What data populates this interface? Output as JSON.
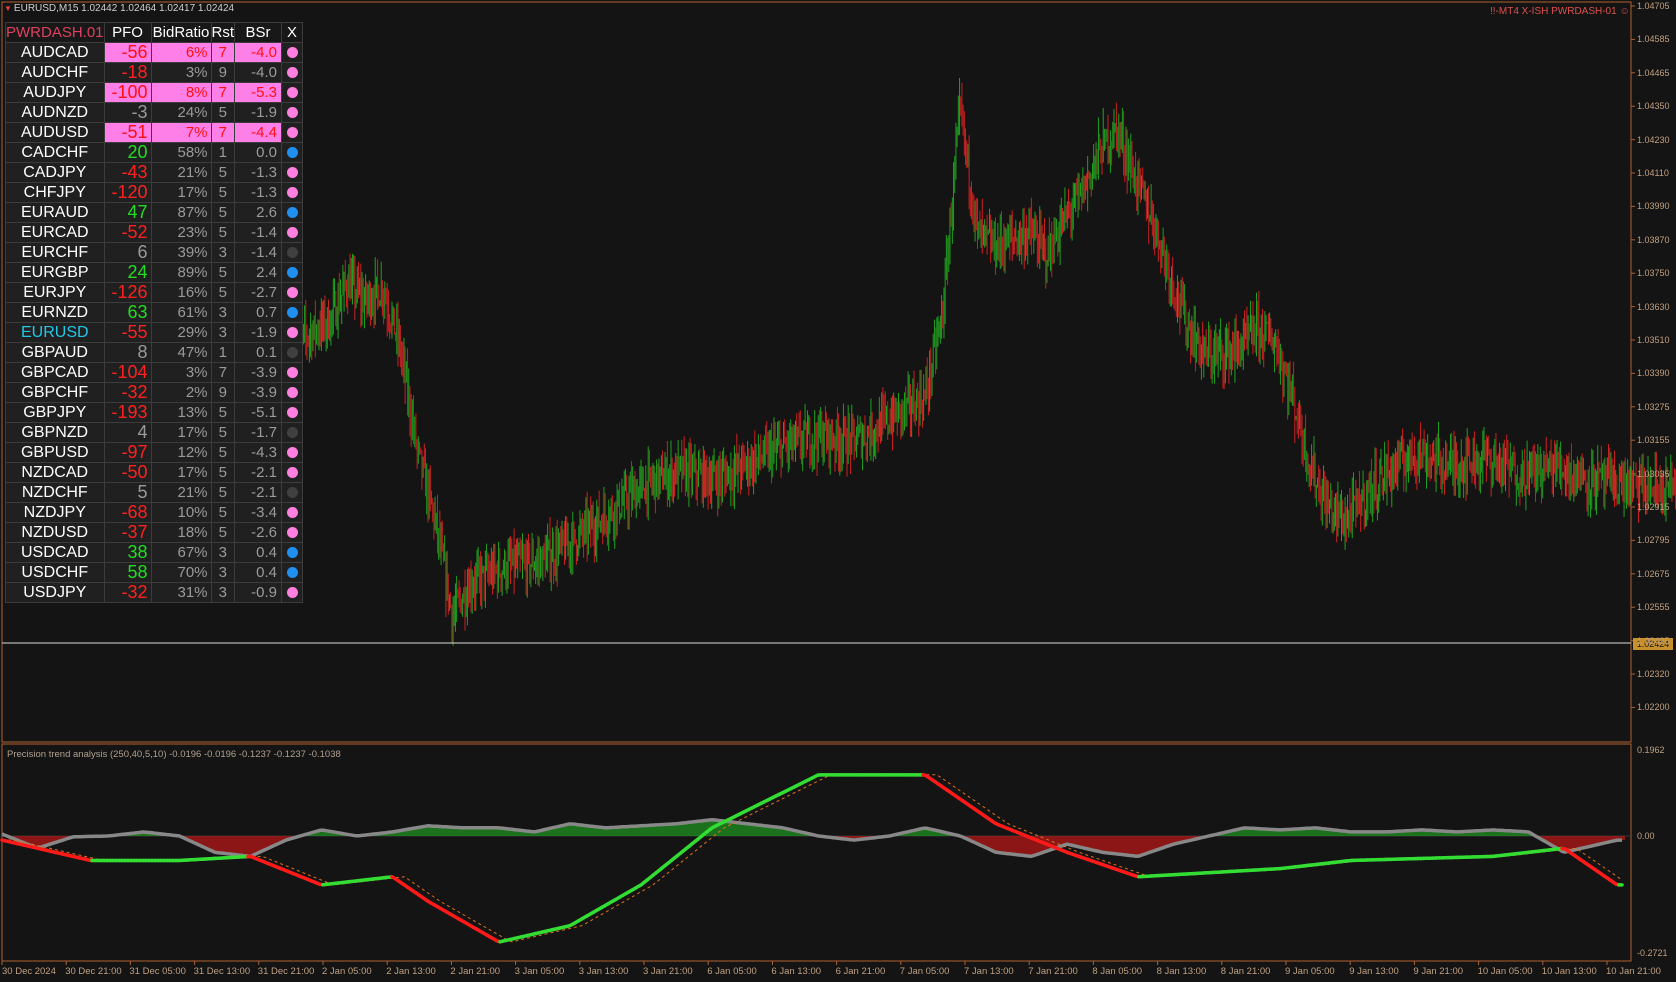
{
  "window": {
    "title_bar": "EURUSD,M15  1.02442 1.02464 1.02417 1.02424",
    "broker_label": "!!-MT4 X-ISH PWRDASH-01 ☺"
  },
  "colors": {
    "background": "#141414",
    "bull_candle": "#1fa01f",
    "bear_candle": "#cc2020",
    "highlight": "#ff7fe8",
    "positive": "#22dd22",
    "negative": "#ff2020",
    "trend_up": "#33dd33",
    "trend_down": "#ff1a1a",
    "momentum": "#888888"
  },
  "dashboard": {
    "headers": [
      "PWRDASH.01",
      "PFO",
      "BidRatio",
      "Rst",
      "BSr",
      "X"
    ],
    "rows": [
      {
        "pair": "AUDCAD",
        "pfo": "-56",
        "ratio": "6%",
        "rst": "7",
        "bsr": "-4.0",
        "dot": "pink",
        "hl": true
      },
      {
        "pair": "AUDCHF",
        "pfo": "-18",
        "ratio": "3%",
        "rst": "9",
        "bsr": "-4.0",
        "dot": "pink",
        "ratio_red": true,
        "bsr_red": true
      },
      {
        "pair": "AUDJPY",
        "pfo": "-100",
        "ratio": "8%",
        "rst": "7",
        "bsr": "-5.3",
        "dot": "pink",
        "hl": true
      },
      {
        "pair": "AUDNZD",
        "pfo": "-3",
        "ratio": "24%",
        "rst": "5",
        "bsr": "-1.9",
        "dot": "pink"
      },
      {
        "pair": "AUDUSD",
        "pfo": "-51",
        "ratio": "7%",
        "rst": "7",
        "bsr": "-4.4",
        "dot": "pink",
        "hl": true
      },
      {
        "pair": "CADCHF",
        "pfo": "20",
        "ratio": "58%",
        "rst": "1",
        "bsr": "0.0",
        "dot": "blue"
      },
      {
        "pair": "CADJPY",
        "pfo": "-43",
        "ratio": "21%",
        "rst": "5",
        "bsr": "-1.3",
        "dot": "pink"
      },
      {
        "pair": "CHFJPY",
        "pfo": "-120",
        "ratio": "17%",
        "rst": "5",
        "bsr": "-1.3",
        "dot": "pink"
      },
      {
        "pair": "EURAUD",
        "pfo": "47",
        "ratio": "87%",
        "rst": "5",
        "bsr": "2.6",
        "dot": "blue"
      },
      {
        "pair": "EURCAD",
        "pfo": "-52",
        "ratio": "23%",
        "rst": "5",
        "bsr": "-1.4",
        "dot": "pink"
      },
      {
        "pair": "EURCHF",
        "pfo": "6",
        "ratio": "39%",
        "rst": "3",
        "bsr": "-1.4",
        "dot": "gray"
      },
      {
        "pair": "EURGBP",
        "pfo": "24",
        "ratio": "89%",
        "rst": "5",
        "bsr": "2.4",
        "dot": "blue"
      },
      {
        "pair": "EURJPY",
        "pfo": "-126",
        "ratio": "16%",
        "rst": "5",
        "bsr": "-2.7",
        "dot": "pink"
      },
      {
        "pair": "EURNZD",
        "pfo": "63",
        "ratio": "61%",
        "rst": "3",
        "bsr": "0.7",
        "dot": "blue"
      },
      {
        "pair": "EURUSD",
        "pfo": "-55",
        "ratio": "29%",
        "rst": "3",
        "bsr": "-1.9",
        "dot": "pink",
        "selected": true
      },
      {
        "pair": "GBPAUD",
        "pfo": "8",
        "ratio": "47%",
        "rst": "1",
        "bsr": "0.1",
        "dot": "gray"
      },
      {
        "pair": "GBPCAD",
        "pfo": "-104",
        "ratio": "3%",
        "rst": "7",
        "bsr": "-3.9",
        "dot": "pink",
        "ratio_red": true,
        "rst_red": true
      },
      {
        "pair": "GBPCHF",
        "pfo": "-32",
        "ratio": "2%",
        "rst": "9",
        "bsr": "-3.9",
        "dot": "pink",
        "ratio_red": true,
        "rst_red": true
      },
      {
        "pair": "GBPJPY",
        "pfo": "-193",
        "ratio": "13%",
        "rst": "5",
        "bsr": "-5.1",
        "dot": "pink",
        "bsr_red": true
      },
      {
        "pair": "GBPNZD",
        "pfo": "4",
        "ratio": "17%",
        "rst": "5",
        "bsr": "-1.7",
        "dot": "gray"
      },
      {
        "pair": "GBPUSD",
        "pfo": "-97",
        "ratio": "12%",
        "rst": "5",
        "bsr": "-4.3",
        "dot": "pink",
        "bsr_red": true
      },
      {
        "pair": "NZDCAD",
        "pfo": "-50",
        "ratio": "17%",
        "rst": "5",
        "bsr": "-2.1",
        "dot": "pink"
      },
      {
        "pair": "NZDCHF",
        "pfo": "5",
        "ratio": "21%",
        "rst": "5",
        "bsr": "-2.1",
        "dot": "gray"
      },
      {
        "pair": "NZDJPY",
        "pfo": "-68",
        "ratio": "10%",
        "rst": "5",
        "bsr": "-3.4",
        "dot": "pink"
      },
      {
        "pair": "NZDUSD",
        "pfo": "-37",
        "ratio": "18%",
        "rst": "5",
        "bsr": "-2.6",
        "dot": "pink"
      },
      {
        "pair": "USDCAD",
        "pfo": "38",
        "ratio": "67%",
        "rst": "3",
        "bsr": "0.4",
        "dot": "blue"
      },
      {
        "pair": "USDCHF",
        "pfo": "58",
        "ratio": "70%",
        "rst": "3",
        "bsr": "0.4",
        "dot": "blue"
      },
      {
        "pair": "USDJPY",
        "pfo": "-32",
        "ratio": "31%",
        "rst": "3",
        "bsr": "-0.9",
        "dot": "pink"
      }
    ]
  },
  "price_axis": [
    "1.04705",
    "1.04585",
    "1.04465",
    "1.04350",
    "1.04230",
    "1.04110",
    "1.03990",
    "1.03870",
    "1.03750",
    "1.03630",
    "1.03510",
    "1.03390",
    "1.03275",
    "1.03155",
    "1.03035",
    "1.02915",
    "1.02795",
    "1.02675",
    "1.02555",
    "1.02435",
    "1.02320",
    "1.02200"
  ],
  "current_price": "1.02424",
  "indicator": {
    "title": "Precision trend analysis (250,40,5,10) -0.0196 -0.0196 -0.1237 -0.1237 -0.1038",
    "axis": [
      "0.1962",
      "0.00",
      "-0.2721"
    ]
  },
  "time_axis": [
    "30 Dec 2024",
    "30 Dec 21:00",
    "31 Dec 05:00",
    "31 Dec 13:00",
    "31 Dec 21:00",
    "2 Jan 05:00",
    "2 Jan 13:00",
    "2 Jan 21:00",
    "3 Jan 05:00",
    "3 Jan 13:00",
    "3 Jan 21:00",
    "6 Jan 05:00",
    "6 Jan 13:00",
    "6 Jan 21:00",
    "7 Jan 05:00",
    "7 Jan 13:00",
    "7 Jan 21:00",
    "8 Jan 05:00",
    "8 Jan 13:00",
    "8 Jan 21:00",
    "9 Jan 05:00",
    "9 Jan 13:00",
    "9 Jan 21:00",
    "10 Jan 05:00",
    "10 Jan 13:00",
    "10 Jan 21:00"
  ],
  "chart_data": {
    "type": "candlestick",
    "symbol": "EURUSD",
    "timeframe": "M15",
    "ylim": [
      1.021,
      1.0472
    ],
    "price_path": [
      [
        0,
        1.035
      ],
      [
        2,
        1.0358
      ],
      [
        3,
        1.0372
      ],
      [
        4,
        1.0365
      ],
      [
        5,
        1.037
      ],
      [
        6,
        1.0348
      ],
      [
        7,
        1.031
      ],
      [
        8,
        1.0285
      ],
      [
        9,
        1.025
      ],
      [
        10,
        1.0262
      ],
      [
        12,
        1.0268
      ],
      [
        14,
        1.027
      ],
      [
        16,
        1.0278
      ],
      [
        18,
        1.0288
      ],
      [
        20,
        1.0298
      ],
      [
        22,
        1.0303
      ],
      [
        24,
        1.03
      ],
      [
        26,
        1.0306
      ],
      [
        28,
        1.0312
      ],
      [
        30,
        1.0316
      ],
      [
        32,
        1.0314
      ],
      [
        34,
        1.0322
      ],
      [
        36,
        1.033
      ],
      [
        37,
        1.036
      ],
      [
        38,
        1.0435
      ],
      [
        39,
        1.039
      ],
      [
        40,
        1.0385
      ],
      [
        42,
        1.039
      ],
      [
        43,
        1.0382
      ],
      [
        44,
        1.0395
      ],
      [
        45,
        1.0405
      ],
      [
        46,
        1.042
      ],
      [
        47,
        1.0428
      ],
      [
        48,
        1.041
      ],
      [
        49,
        1.0395
      ],
      [
        50,
        1.0375
      ],
      [
        51,
        1.0356
      ],
      [
        52,
        1.0345
      ],
      [
        54,
        1.0348
      ],
      [
        55,
        1.0355
      ],
      [
        56,
        1.035
      ],
      [
        57,
        1.033
      ],
      [
        58,
        1.0305
      ],
      [
        59,
        1.029
      ],
      [
        60,
        1.0285
      ],
      [
        62,
        1.03
      ],
      [
        64,
        1.031
      ],
      [
        66,
        1.0305
      ],
      [
        68,
        1.0308
      ],
      [
        70,
        1.0302
      ],
      [
        72,
        1.0305
      ],
      [
        74,
        1.03
      ],
      [
        76,
        1.0298
      ],
      [
        78,
        1.0296
      ],
      [
        80,
        1.03
      ],
      [
        82,
        1.0295
      ],
      [
        83,
        1.0288
      ],
      [
        84,
        1.0302
      ],
      [
        86,
        1.0306
      ],
      [
        87,
        1.03
      ],
      [
        88,
        1.025
      ],
      [
        89,
        1.024
      ],
      [
        90,
        1.0242
      ],
      [
        91,
        1.024
      ]
    ]
  },
  "indicator_data": {
    "trend_line": [
      [
        0,
        -0.01
      ],
      [
        5,
        -0.06
      ],
      [
        10,
        -0.06
      ],
      [
        14,
        -0.05
      ],
      [
        18,
        -0.12
      ],
      [
        22,
        -0.1
      ],
      [
        24,
        -0.16
      ],
      [
        28,
        -0.26
      ],
      [
        32,
        -0.22
      ],
      [
        36,
        -0.12
      ],
      [
        40,
        0.02
      ],
      [
        46,
        0.15
      ],
      [
        52,
        0.15
      ],
      [
        56,
        0.03
      ],
      [
        60,
        -0.04
      ],
      [
        64,
        -0.1
      ],
      [
        68,
        -0.09
      ],
      [
        72,
        -0.08
      ],
      [
        76,
        -0.06
      ],
      [
        84,
        -0.05
      ],
      [
        88,
        -0.03
      ],
      [
        91,
        -0.12
      ]
    ],
    "momentum": [
      [
        0,
        0.005
      ],
      [
        2,
        -0.03
      ],
      [
        4,
        -0.002
      ],
      [
        6,
        0.0
      ],
      [
        8,
        0.01
      ],
      [
        10,
        0.0
      ],
      [
        12,
        -0.04
      ],
      [
        14,
        -0.05
      ],
      [
        16,
        -0.01
      ],
      [
        18,
        0.015
      ],
      [
        20,
        0.0
      ],
      [
        22,
        0.01
      ],
      [
        24,
        0.025
      ],
      [
        26,
        0.02
      ],
      [
        28,
        0.02
      ],
      [
        30,
        0.01
      ],
      [
        32,
        0.03
      ],
      [
        34,
        0.02
      ],
      [
        36,
        0.025
      ],
      [
        38,
        0.03
      ],
      [
        40,
        0.04
      ],
      [
        44,
        0.02
      ],
      [
        46,
        0.0
      ],
      [
        48,
        -0.01
      ],
      [
        50,
        0.0
      ],
      [
        52,
        0.02
      ],
      [
        54,
        0.0
      ],
      [
        56,
        -0.04
      ],
      [
        58,
        -0.05
      ],
      [
        60,
        -0.02
      ],
      [
        62,
        -0.04
      ],
      [
        64,
        -0.05
      ],
      [
        66,
        -0.02
      ],
      [
        68,
        0.0
      ],
      [
        70,
        0.02
      ],
      [
        72,
        0.015
      ],
      [
        74,
        0.02
      ],
      [
        76,
        0.01
      ],
      [
        78,
        0.01
      ],
      [
        80,
        0.015
      ],
      [
        82,
        0.01
      ],
      [
        84,
        0.015
      ],
      [
        86,
        0.01
      ],
      [
        88,
        -0.04
      ],
      [
        90,
        -0.02
      ],
      [
        91,
        -0.01
      ]
    ]
  }
}
